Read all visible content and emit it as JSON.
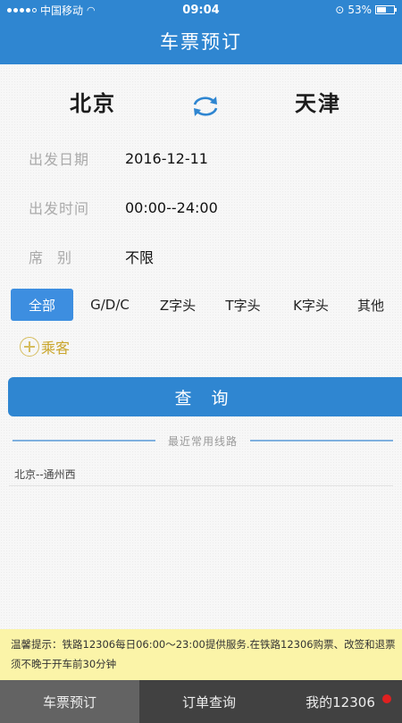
{
  "status_bar": {
    "carrier": "中国移动",
    "time": "09:04",
    "battery": "53%",
    "battery_level": 0.53
  },
  "header": {
    "title": "车票预订"
  },
  "route": {
    "from": "北京",
    "to": "天津"
  },
  "form": {
    "date_label": "出发日期",
    "date_value": "2016-12-11",
    "time_label": "出发时间",
    "time_value": "00:00--24:00",
    "seat_label": "席别",
    "seat_value": "不限"
  },
  "filters": [
    "全部",
    "G/D/C",
    "Z字头",
    "T字头",
    "K字头",
    "其他"
  ],
  "passenger_label": "乘客",
  "query_button": "查 询",
  "recent": {
    "title": "最近常用线路",
    "items": [
      "北京--通州西"
    ]
  },
  "tip": "温馨提示：铁路12306每日06:00～23:00提供服务.在铁路12306购票、改签和退票须不晚于开车前30分钟",
  "tabs": [
    "车票预订",
    "订单查询",
    "我的12306"
  ],
  "colors": {
    "brand_blue": "#2f86d1",
    "tip_yellow": "#fbf4a8",
    "tab_bg": "#414141"
  }
}
